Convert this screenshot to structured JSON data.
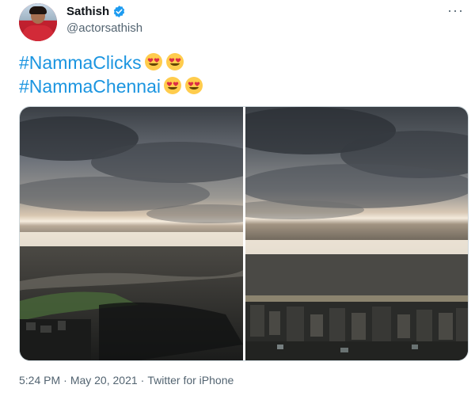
{
  "user": {
    "display_name": "Sathish",
    "handle": "@actorsathish",
    "verified": true
  },
  "tweet": {
    "hashtags": [
      "#NammaClicks",
      "#NammaChennai"
    ],
    "emoji_icon": "heart-eyes-emoji-icon"
  },
  "media": {
    "count": 2,
    "items": [
      {
        "description_icon": "storm-clouds-beach-photo"
      },
      {
        "description_icon": "storm-clouds-city-photo"
      }
    ]
  },
  "meta": {
    "time": "5:24 PM",
    "separator": "·",
    "date": "May 20, 2021",
    "source": "Twitter for iPhone"
  },
  "colors": {
    "link": "#1b95e0",
    "verified": "#1d9bf0",
    "secondary_text": "#536471"
  }
}
